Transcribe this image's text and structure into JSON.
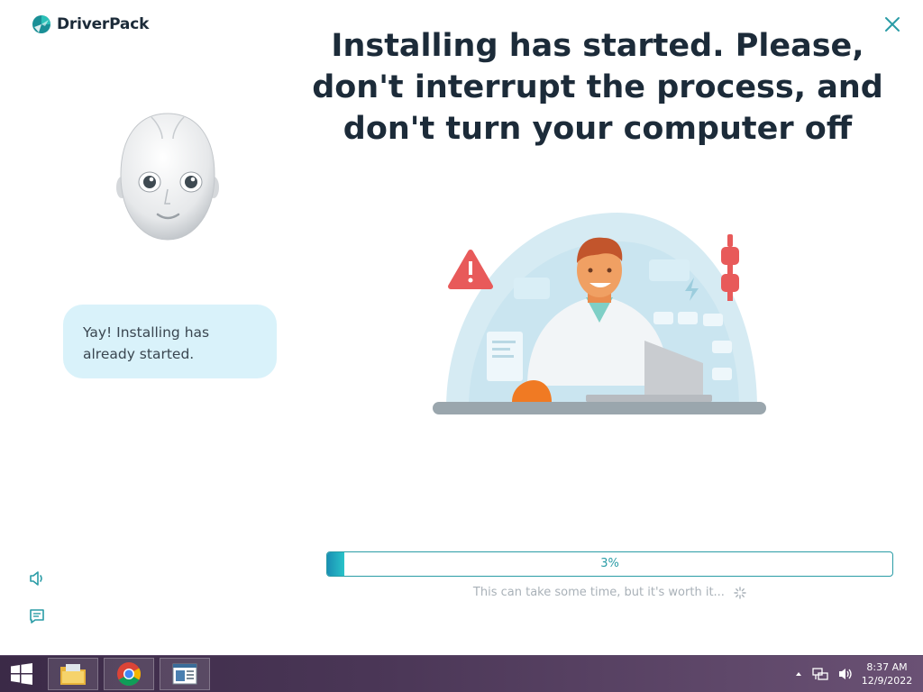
{
  "app": {
    "brand": "DriverPack",
    "headline": "Installing has started. Please, don't interrupt the process, and don't turn your computer off",
    "assistant_message": "Yay! Installing has already started.",
    "progress": {
      "value": 0.03,
      "label": "3%"
    },
    "hint": "This can take some time, but it's worth it...",
    "icons": {
      "close": "close-icon",
      "sound": "speaker-icon",
      "chat": "chat-icon",
      "avatar": "robot-avatar",
      "illustration": "doctor-installing-illustration"
    },
    "colors": {
      "accent": "#2a9ca6",
      "headline": "#1c2b39",
      "bubble": "#d9f2fa",
      "hint": "#a9b1b8"
    }
  },
  "taskbar": {
    "apps": [
      "file-explorer-icon",
      "chrome-icon",
      "driverpack-window-icon"
    ],
    "tray_icons": [
      "show-hidden-icons-icon",
      "network-icon",
      "volume-icon"
    ],
    "time": "8:37 AM",
    "date": "12/9/2022"
  }
}
